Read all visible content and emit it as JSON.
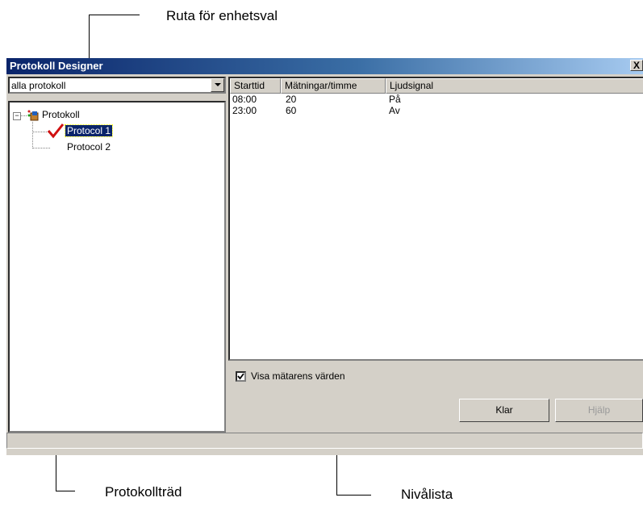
{
  "callouts": {
    "top": "Ruta för enhetsval",
    "bottom_left": "Protokollträd",
    "bottom_right": "Nivålista"
  },
  "window": {
    "title": "Protokoll Designer",
    "close_label": "X"
  },
  "combo": {
    "value": "alla protokoll"
  },
  "tree": {
    "root": "Protokoll",
    "items": [
      "Protocol 1",
      "Protocol 2"
    ],
    "selected": "Protocol 1"
  },
  "list": {
    "headers": [
      "Starttid",
      "Mätningar/timme",
      "Ljudsignal"
    ],
    "rows": [
      [
        "08:00",
        "20",
        "På"
      ],
      [
        "23:00",
        "60",
        "Av"
      ]
    ]
  },
  "checkbox": {
    "label": "Visa mätarens värden",
    "checked": true
  },
  "buttons": {
    "done": "Klar",
    "help": "Hjälp"
  },
  "icons": {
    "protocol_root": "protocol-folder-icon",
    "active_marker": "red-checkmark-icon",
    "combo_arrow": "chevron-down-icon"
  }
}
